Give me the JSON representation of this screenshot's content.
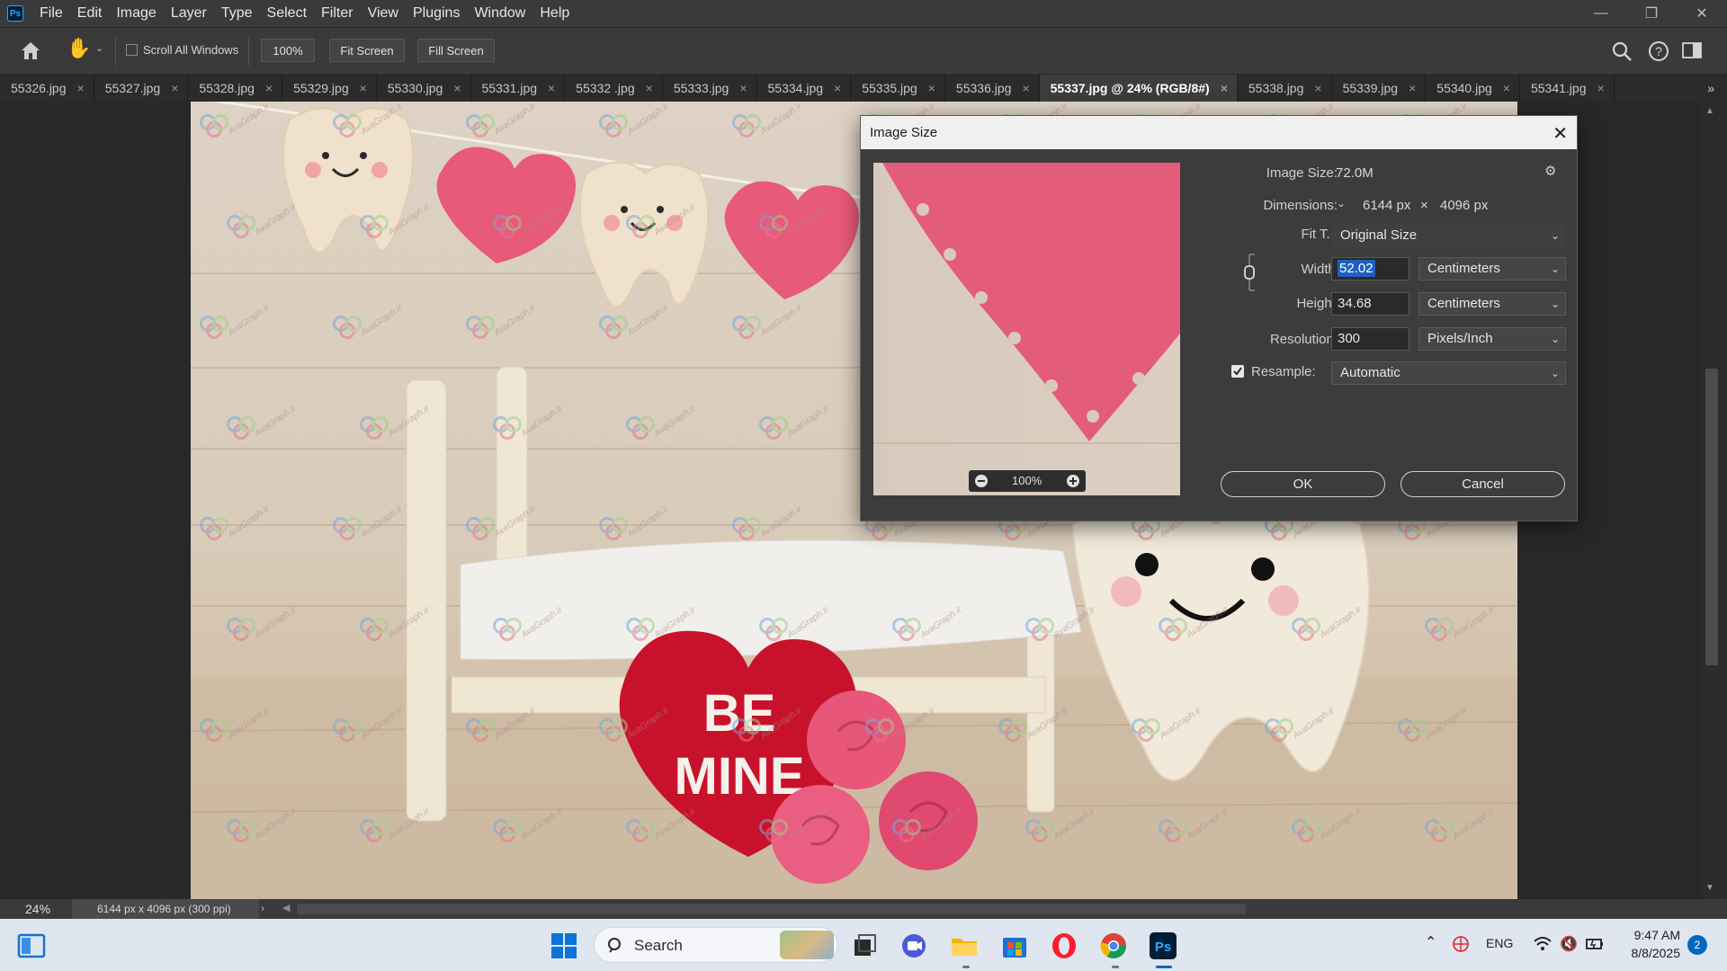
{
  "app": {
    "menu": [
      "File",
      "Edit",
      "Image",
      "Layer",
      "Type",
      "Select",
      "Filter",
      "View",
      "Plugins",
      "Window",
      "Help"
    ],
    "logo_text": "Ps"
  },
  "options_bar": {
    "scroll_all_windows": "Scroll All Windows",
    "zoom_button": "100%",
    "fit_screen": "Fit Screen",
    "fill_screen": "Fill Screen"
  },
  "tabs": [
    {
      "label": "55326.jpg",
      "active": false
    },
    {
      "label": "55327.jpg",
      "active": false
    },
    {
      "label": "55328.jpg",
      "active": false
    },
    {
      "label": "55329.jpg",
      "active": false
    },
    {
      "label": "55330.jpg",
      "active": false
    },
    {
      "label": "55331.jpg",
      "active": false
    },
    {
      "label": "55332 .jpg",
      "active": false
    },
    {
      "label": "55333.jpg",
      "active": false
    },
    {
      "label": "55334.jpg",
      "active": false
    },
    {
      "label": "55335.jpg",
      "active": false
    },
    {
      "label": "55336.jpg",
      "active": false
    },
    {
      "label": "55337.jpg @ 24% (RGB/8#)",
      "active": true
    },
    {
      "label": "55338.jpg",
      "active": false
    },
    {
      "label": "55339.jpg",
      "active": false
    },
    {
      "label": "55340.jpg",
      "active": false
    },
    {
      "label": "55341.jpg",
      "active": false
    }
  ],
  "tab_more": "»",
  "canvas": {
    "sign_line1": "BE",
    "sign_line2": "MINE",
    "watermark_text": "AvaGraph.ir"
  },
  "status_bar": {
    "zoom": "24%",
    "doc_info": "6144 px x 4096 px (300 ppi)",
    "arrow": "›"
  },
  "dialog": {
    "title": "Image Size",
    "image_size_label": "Image Size:",
    "image_size_value": "72.0M",
    "dimensions_label": "Dimensions:",
    "dim_width": "6144 px",
    "dim_times": "×",
    "dim_height": "4096 px",
    "fit_to_label": "Fit T...",
    "fit_to_value": "Original Size",
    "width_label": "Width:",
    "width_value": "52.02",
    "width_unit": "Centimeters",
    "height_label": "Height:",
    "height_value": "34.68",
    "height_unit": "Centimeters",
    "resolution_label": "Resolution:",
    "resolution_value": "300",
    "resolution_unit": "Pixels/Inch",
    "resample_label": "Resample:",
    "resample_value": "Automatic",
    "resample_checked": true,
    "preview_zoom": "100%",
    "ok": "OK",
    "cancel": "Cancel"
  },
  "taskbar": {
    "search_text": "Search",
    "lang": "ENG",
    "time": "9:47 AM",
    "date": "8/8/2025",
    "notification_count": "2"
  },
  "colors": {
    "accent_blue": "#31a8ff",
    "selection_blue": "#1f5fbf",
    "heart_pink": "#e85a7a",
    "sign_red": "#c8122b"
  }
}
